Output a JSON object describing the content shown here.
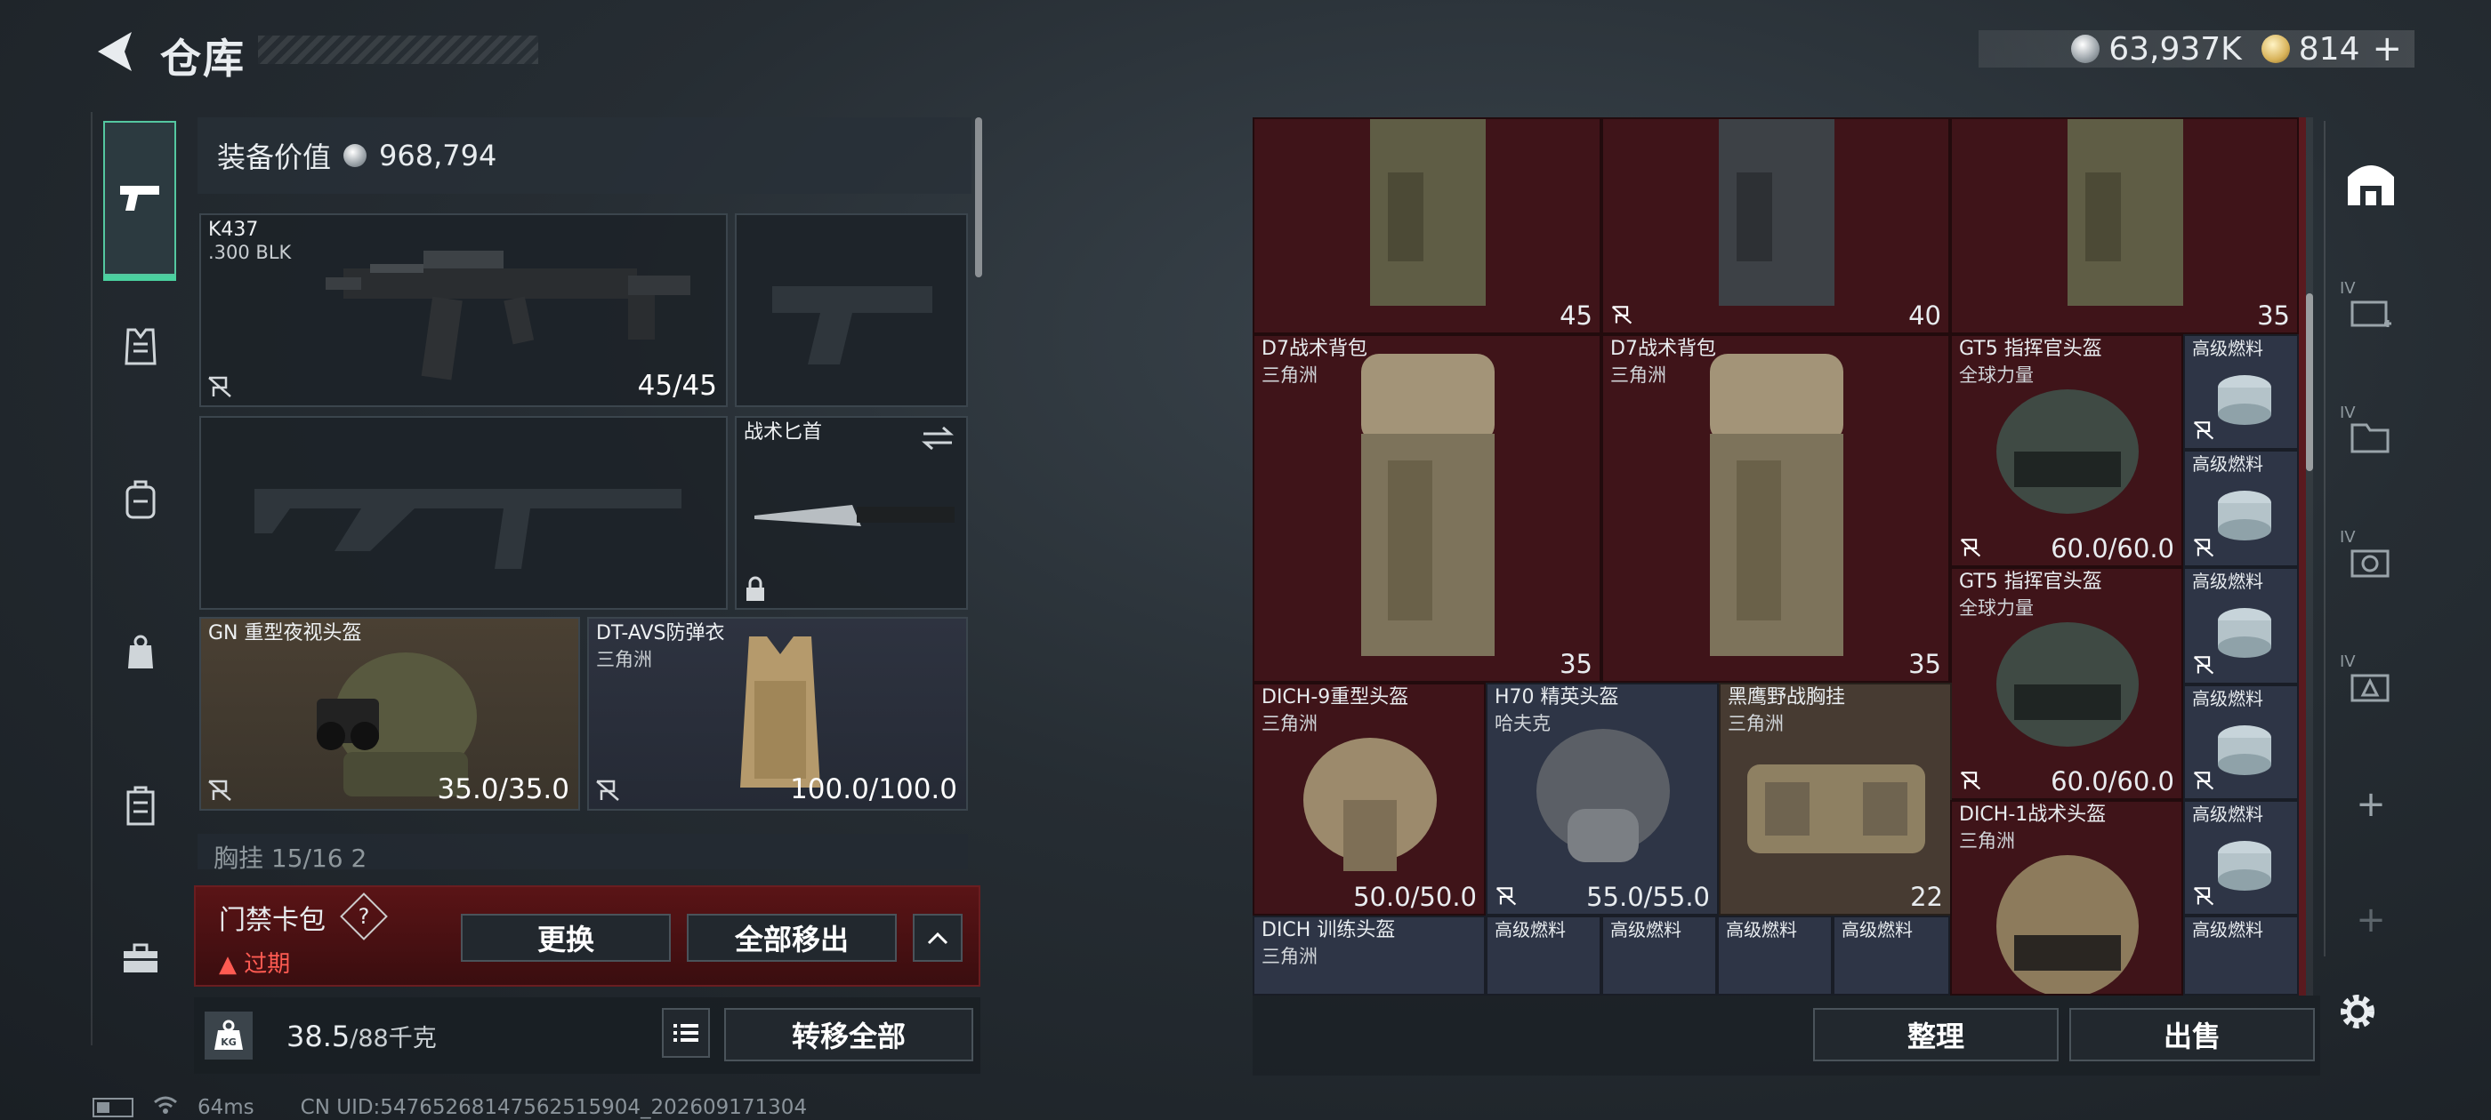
{
  "header": {
    "title": "仓库",
    "currency": [
      {
        "icon": "silver-coin-icon",
        "value": "63,937K"
      },
      {
        "icon": "gold-coin-icon",
        "value": "814"
      }
    ],
    "add_label": "+"
  },
  "equipment": {
    "value_label": "装备价值",
    "value": "968,794",
    "primary_weapon": {
      "name": "K437",
      "ammo": ".300 BLK",
      "durability": "45/45"
    },
    "knife": {
      "name": "战术匕首"
    },
    "helmet": {
      "name": "GN 重型夜视头盔",
      "durability": "35.0/35.0"
    },
    "armor": {
      "name": "DT-AVS防弹衣",
      "sub": "三角洲",
      "durability": "100.0/100.0"
    },
    "chest_rig_partial": "胸挂  15/16   2"
  },
  "access_card": {
    "title": "门禁卡包",
    "help": "?",
    "status": "过期",
    "replace_label": "更换",
    "remove_all_label": "全部移出",
    "collapse_icon": "^"
  },
  "weight": {
    "icon_label": "KG",
    "current": "38.5",
    "max": "/88千克",
    "transfer_all_label": "转移全部"
  },
  "status_bar": {
    "ping": "64ms",
    "uid": "CN UID:547652681475625159​04_202609171304"
  },
  "stash": {
    "items": [
      {
        "name": "",
        "sub": "",
        "value": "45"
      },
      {
        "name": "",
        "sub": "",
        "value": "40"
      },
      {
        "name": "",
        "sub": "",
        "value": "35"
      },
      {
        "name": "D7战术背包",
        "sub": "三角洲",
        "value": "35"
      },
      {
        "name": "D7战术背包",
        "sub": "三角洲",
        "value": "35"
      },
      {
        "name": "GT5 指挥官头盔",
        "sub": "全球力量",
        "value": "60.0/60.0"
      },
      {
        "name": "GT5 指挥官头盔",
        "sub": "全球力量",
        "value": "60.0/60.0"
      },
      {
        "name": "DICH-9重型头盔",
        "sub": "三角洲",
        "value": "50.0/50.0"
      },
      {
        "name": "H70 精英头盔",
        "sub": "哈夫克",
        "value": "55.0/55.0"
      },
      {
        "name": "黑鹰野战胸挂",
        "sub": "三角洲",
        "value": "22"
      },
      {
        "name": "DICH-1战术头盔",
        "sub": "三角洲",
        "value": ""
      },
      {
        "name": "DICH 训练头盔",
        "sub": "三角洲",
        "value": ""
      }
    ],
    "fuel_label": "高级燃料",
    "sort_label": "整理",
    "sell_label": "出售"
  },
  "right_tabs": {
    "iv_label": "IV",
    "add_label": "+"
  }
}
